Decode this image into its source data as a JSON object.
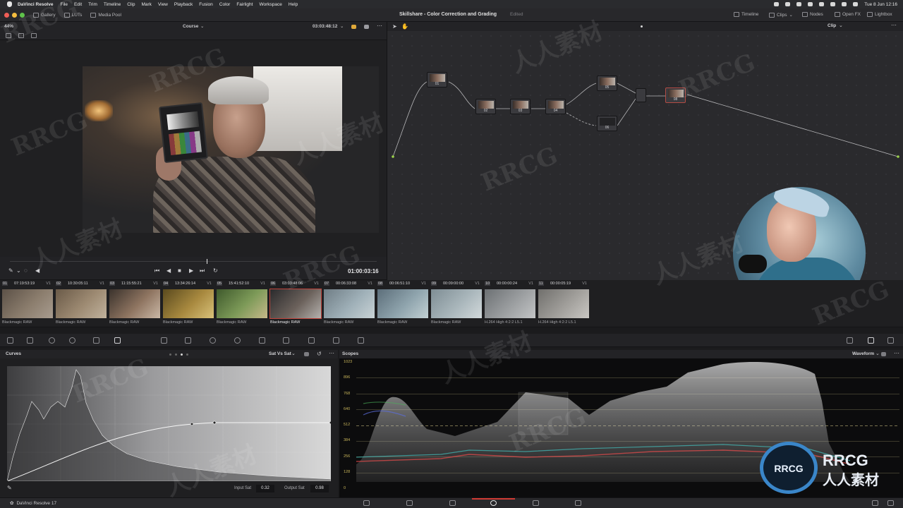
{
  "menubar": {
    "app": "DaVinci Resolve",
    "items": [
      "File",
      "Edit",
      "Trim",
      "Timeline",
      "Clip",
      "Mark",
      "View",
      "Playback",
      "Fusion",
      "Color",
      "Fairlight",
      "Workspace",
      "Help"
    ],
    "datetime": "Tue 8 Jun  12:16"
  },
  "topbar": {
    "gallery": "Gallery",
    "luts": "LUTs",
    "media_pool": "Media Pool",
    "project_title": "Skillshare - Color Correction and Grading",
    "edited": "Edited",
    "timeline": "Timeline",
    "clips": "Clips",
    "nodes": "Nodes",
    "open_fx": "Open FX",
    "lightbox": "Lightbox"
  },
  "viewer": {
    "zoom": "44%",
    "timeline_name": "Course",
    "header_timecode": "03:03:48:12",
    "timecode": "01:00:03:16"
  },
  "node_editor": {
    "mode": "Clip",
    "nodes": [
      "01",
      "02",
      "03",
      "04",
      "05",
      "06",
      "08"
    ]
  },
  "clips": [
    {
      "num": "01",
      "tc": "07:19:53:19",
      "track": "V1",
      "codec": "Blackmagic RAW",
      "tint": [
        "#5c5147",
        "#8b7d6d",
        "#a89c8f"
      ]
    },
    {
      "num": "02",
      "tc": "10:30:05:11",
      "track": "V1",
      "codec": "Blackmagic RAW",
      "tint": [
        "#6a5a48",
        "#9d8a72",
        "#c0b29d"
      ]
    },
    {
      "num": "03",
      "tc": "11:15:55:21",
      "track": "V1",
      "codec": "Blackmagic RAW",
      "tint": [
        "#3a322c",
        "#8e7460",
        "#cab8a6"
      ]
    },
    {
      "num": "04",
      "tc": "13:34:26:14",
      "track": "V1",
      "codec": "Blackmagic RAW",
      "tint": [
        "#5a4a1e",
        "#a8893f",
        "#d9c27a"
      ]
    },
    {
      "num": "05",
      "tc": "15:41:52:10",
      "track": "V1",
      "codec": "Blackmagic RAW",
      "tint": [
        "#3f5a2c",
        "#7d9a58",
        "#c7b98a"
      ]
    },
    {
      "num": "06",
      "tc": "03:03:48:06",
      "track": "V1",
      "codec": "Blackmagic RAW",
      "tint": [
        "#2a2a2c",
        "#6b615b",
        "#b5b2ae"
      ]
    },
    {
      "num": "07",
      "tc": "00:06:33:08",
      "track": "V1",
      "codec": "Blackmagic RAW",
      "tint": [
        "#6f7d85",
        "#9fb0b8",
        "#c9d3d6"
      ]
    },
    {
      "num": "08",
      "tc": "00:06:51:10",
      "track": "V1",
      "codec": "Blackmagic RAW",
      "tint": [
        "#5c6e7a",
        "#8fa4ad",
        "#c2d0d3"
      ]
    },
    {
      "num": "09",
      "tc": "00:09:00:00",
      "track": "V1",
      "codec": "Blackmagic RAW",
      "tint": [
        "#7e8d94",
        "#a9b6bb",
        "#d2d9db"
      ]
    },
    {
      "num": "10",
      "tc": "00:00:00:24",
      "track": "V1",
      "codec": "H.264 High 4:2:2 L5.1",
      "tint": [
        "#6c7073",
        "#9c9fa1",
        "#c3c5c6"
      ]
    },
    {
      "num": "11",
      "tc": "00:00:05:19",
      "track": "V1",
      "codec": "H.264 High 4:2:2 L5.1",
      "tint": [
        "#706f6c",
        "#a19f9b",
        "#c9c7c3"
      ]
    }
  ],
  "curves": {
    "title": "Curves",
    "mode": "Sat Vs Sat",
    "input_sat_label": "Input Sat",
    "input_sat": "0.32",
    "output_sat_label": "Output Sat",
    "output_sat": "0.98"
  },
  "scopes": {
    "title": "Scopes",
    "mode": "Waveform",
    "scale": [
      "1023",
      "896",
      "768",
      "640",
      "512",
      "384",
      "256",
      "128",
      "0"
    ]
  },
  "bottombar": {
    "app_version": "DaVinci Resolve 17"
  },
  "watermark": {
    "text_latin": "RRCG",
    "text_cjk": "人人素材"
  }
}
